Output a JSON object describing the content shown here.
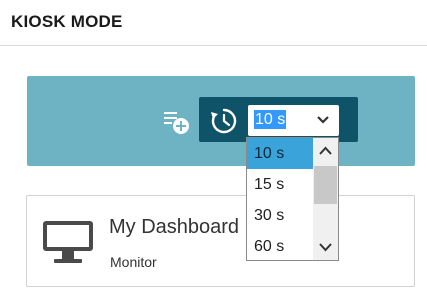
{
  "header": {
    "title": "KIOSK MODE"
  },
  "toolbar": {
    "add_icon": "add-to-list-icon",
    "clock_icon": "clock-icon",
    "interval": {
      "selected": "10 s",
      "options": [
        "10 s",
        "15 s",
        "30 s",
        "60 s"
      ]
    }
  },
  "card": {
    "title": "My Dashboard",
    "subtitle": "Monitor",
    "icon": "monitor-icon"
  },
  "colors": {
    "toolbar_bg": "#6db3c3",
    "timer_bg": "#0f5368",
    "selection": "#3aa3d9"
  }
}
